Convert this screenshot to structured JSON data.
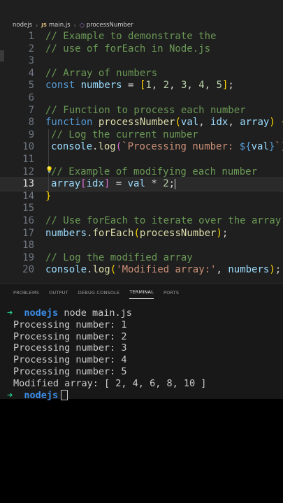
{
  "breadcrumb": {
    "folder": "nodejs",
    "file": "main.js",
    "symbol": "processNumber",
    "file_icon": "JS",
    "symbol_icon": "function-icon"
  },
  "editor": {
    "line_numbers": [
      "1",
      "2",
      "3",
      "4",
      "5",
      "6",
      "7",
      "8",
      "9",
      "10",
      "11",
      "12",
      "13",
      "14",
      "15",
      "16",
      "17",
      "18",
      "19",
      "20"
    ],
    "line1": "// Example to demonstrate the",
    "line2": "// use of forEach in Node.js",
    "line4": "// Array of numbers",
    "line5": {
      "kw": "const",
      "var": "numbers",
      "eq": " = ",
      "open": "[",
      "n1": "1",
      "n2": "2",
      "n3": "3",
      "n4": "4",
      "n5": "5",
      "close": "]",
      "comma": ", ",
      "semi": ";"
    },
    "line7": "// Function to process each number",
    "line8": {
      "kw": "function",
      "name": "processNumber",
      "open": "(",
      "p1": "val",
      "p2": "idx",
      "p3": "array",
      "close": ")",
      "comma": ", ",
      "brace": "{"
    },
    "line9": "// Log the current number",
    "line10": {
      "obj": "console",
      "dot": ".",
      "fn": "log",
      "open": "(",
      "tmpl": "`Processing number: ",
      "interp_open": "${",
      "interp_var": "val",
      "interp_close": "}",
      "tmpl_end": "`",
      "close": ")",
      "semi": ";"
    },
    "line12": "// Example of modifying each number",
    "line13": {
      "arr": "array",
      "b_open": "[",
      "idx": "idx",
      "b_close": "]",
      "eq": " = ",
      "val": "val",
      "op": " * ",
      "num": "2",
      "semi": ";"
    },
    "line14": "}",
    "line16": "// Use forEach to iterate over the array",
    "line17": {
      "obj": "numbers",
      "dot": ".",
      "fn": "forEach",
      "open": "(",
      "arg": "processNumber",
      "close": ")",
      "semi": ";"
    },
    "line19": "// Log the modified array",
    "line20": {
      "obj": "console",
      "dot": ".",
      "fn": "log",
      "open": "(",
      "str": "'Modified array:'",
      "comma": ", ",
      "arg": "numbers",
      "close": ")",
      "semi": ";"
    }
  },
  "panel": {
    "tabs": [
      "PROBLEMS",
      "OUTPUT",
      "DEBUG CONSOLE",
      "TERMINAL",
      "PORTS"
    ],
    "active_tab": "TERMINAL"
  },
  "terminal": {
    "prompt_arrow": "➜",
    "prompt_dir": "nodejs",
    "command": "node main.js",
    "output": [
      "Processing number: 1",
      "Processing number: 2",
      "Processing number: 3",
      "Processing number: 4",
      "Processing number: 5",
      "Modified array: [ 2, 4, 6, 8, 10 ]"
    ]
  }
}
